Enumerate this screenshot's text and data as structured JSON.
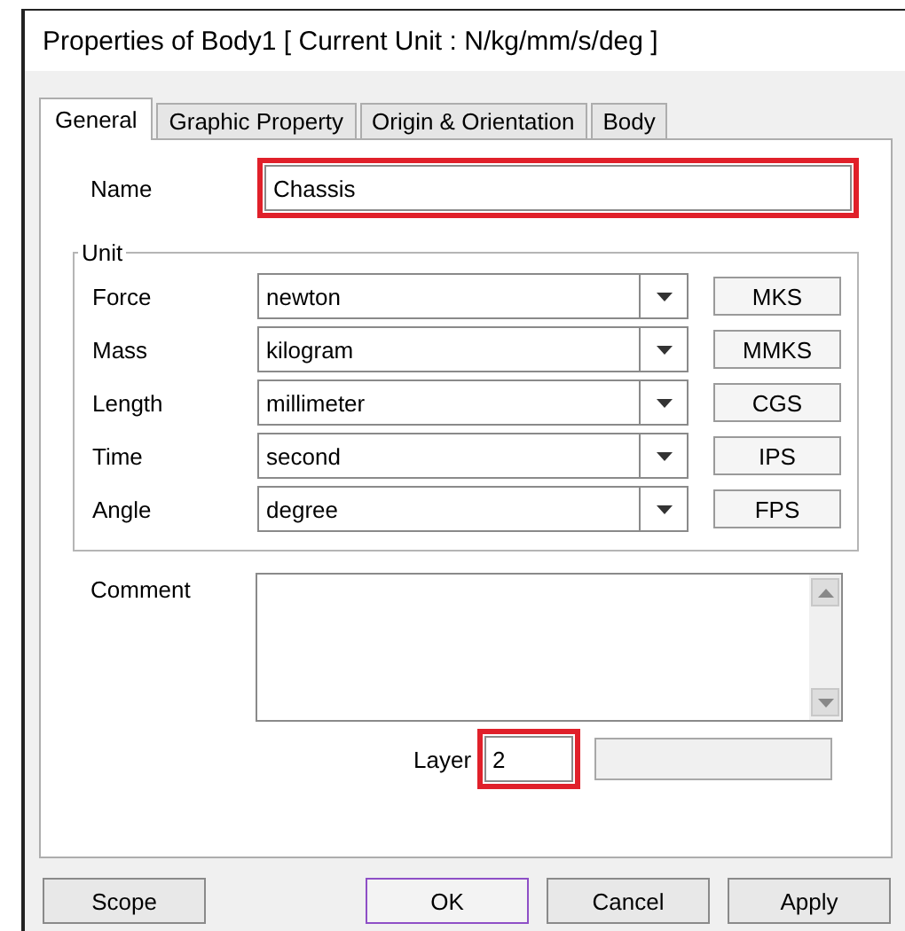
{
  "window": {
    "title": "Properties of Body1 [ Current Unit : N/kg/mm/s/deg ]"
  },
  "tabs": [
    {
      "label": "General",
      "selected": true
    },
    {
      "label": "Graphic Property",
      "selected": false
    },
    {
      "label": "Origin & Orientation",
      "selected": false
    },
    {
      "label": "Body",
      "selected": false
    }
  ],
  "name": {
    "label": "Name",
    "value": "Chassis",
    "highlighted": true
  },
  "unit": {
    "label": "Unit",
    "rows": [
      {
        "label": "Force",
        "value": "newton",
        "preset": "MKS"
      },
      {
        "label": "Mass",
        "value": "kilogram",
        "preset": "MMKS"
      },
      {
        "label": "Length",
        "value": "millimeter",
        "preset": "CGS"
      },
      {
        "label": "Time",
        "value": "second",
        "preset": "IPS"
      },
      {
        "label": "Angle",
        "value": "degree",
        "preset": "FPS"
      }
    ]
  },
  "comment": {
    "label": "Comment"
  },
  "layer": {
    "label": "Layer",
    "value": "2",
    "highlighted": true
  },
  "buttons": [
    {
      "label": "Scope",
      "default": false
    },
    {
      "label": "OK",
      "default": true
    },
    {
      "label": "Cancel",
      "default": false
    },
    {
      "label": "Apply",
      "default": false
    }
  ]
}
